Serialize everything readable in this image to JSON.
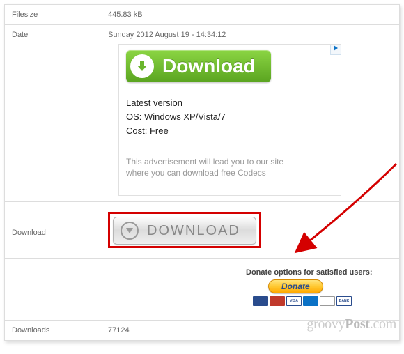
{
  "rows": {
    "filesize": {
      "label": "Filesize",
      "value": "445.83 kB"
    },
    "date": {
      "label": "Date",
      "value": "Sunday 2012 August 19 - 14:34:12"
    },
    "download": {
      "label": "Download",
      "button_text": "DOWNLOAD"
    },
    "downloads": {
      "label": "Downloads",
      "value": "77124"
    }
  },
  "ad": {
    "button_text": "Download",
    "latest": "Latest version",
    "os": "OS: Windows XP/Vista/7",
    "cost": "Cost: Free",
    "disclaimer_line1": "This advertisement will lead you to our site",
    "disclaimer_line2": "where you can download free Codecs"
  },
  "donate": {
    "title": "Donate options for satisfied users:",
    "button": "Donate",
    "cards": [
      "Maestro",
      "MasterCard",
      "VISA",
      "AMEX",
      "Discover",
      "BANK"
    ]
  },
  "watermark": {
    "a": "groovy",
    "b": "Post",
    "c": ".com"
  }
}
